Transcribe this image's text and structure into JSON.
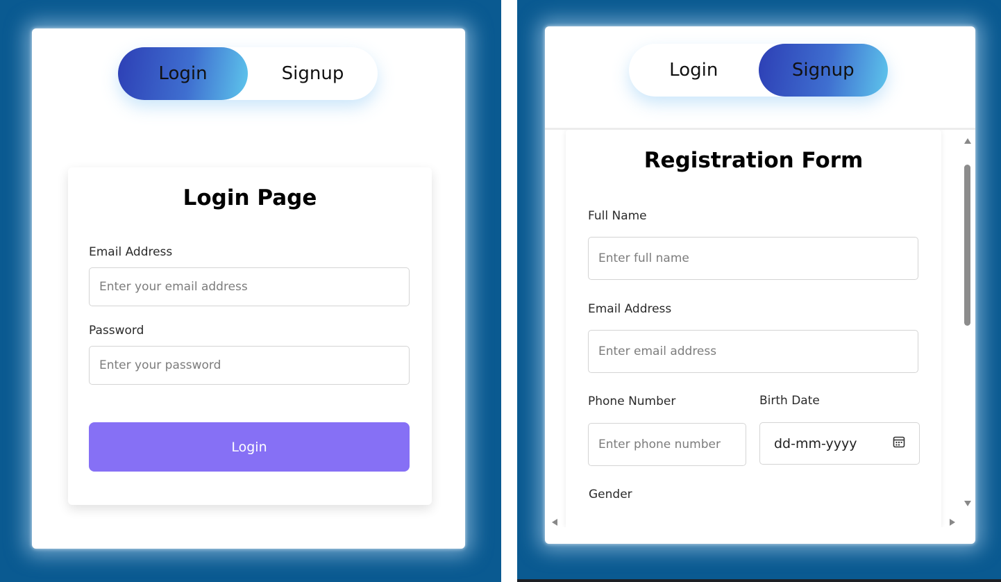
{
  "tabs": {
    "login_label": "Login",
    "signup_label": "Signup"
  },
  "login_form": {
    "title": "Login Page",
    "email_label": "Email Address",
    "email_placeholder": "Enter your email address",
    "password_label": "Password",
    "password_placeholder": "Enter your password",
    "submit_label": "Login"
  },
  "registration_form": {
    "title": "Registration Form",
    "full_name_label": "Full Name",
    "full_name_placeholder": "Enter full name",
    "email_label": "Email Address",
    "email_placeholder": "Enter email address",
    "phone_label": "Phone Number",
    "phone_placeholder": "Enter phone number",
    "birth_date_label": "Birth Date",
    "birth_date_value": "dd-mm-yyyy",
    "gender_label": "Gender"
  },
  "colors": {
    "page_background": "#0a5a91",
    "active_tab_gradient_start": "#2d3fb5",
    "active_tab_gradient_end": "#5ec6ec",
    "primary_button": "#8670f5"
  },
  "icons": {
    "date_picker": "calendar-icon"
  }
}
